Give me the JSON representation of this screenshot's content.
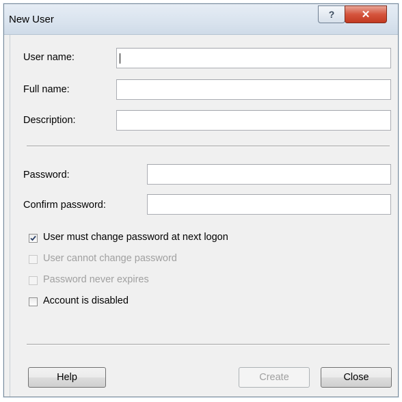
{
  "window": {
    "title": "New User"
  },
  "title_buttons": {
    "help": "?",
    "close": "✕"
  },
  "fields": {
    "user_name": {
      "label": "User name:",
      "value": ""
    },
    "full_name": {
      "label": "Full name:",
      "value": ""
    },
    "description": {
      "label": "Description:",
      "value": ""
    },
    "password": {
      "label": "Password:",
      "value": ""
    },
    "confirm_password": {
      "label": "Confirm password:",
      "value": ""
    }
  },
  "options": [
    {
      "label": "User must change password at next logon",
      "checked": true,
      "disabled": false
    },
    {
      "label": "User cannot change password",
      "checked": false,
      "disabled": true
    },
    {
      "label": "Password never expires",
      "checked": false,
      "disabled": true
    },
    {
      "label": "Account is disabled",
      "checked": false,
      "disabled": false
    }
  ],
  "buttons": {
    "help": "Help",
    "create": "Create",
    "close": "Close"
  }
}
